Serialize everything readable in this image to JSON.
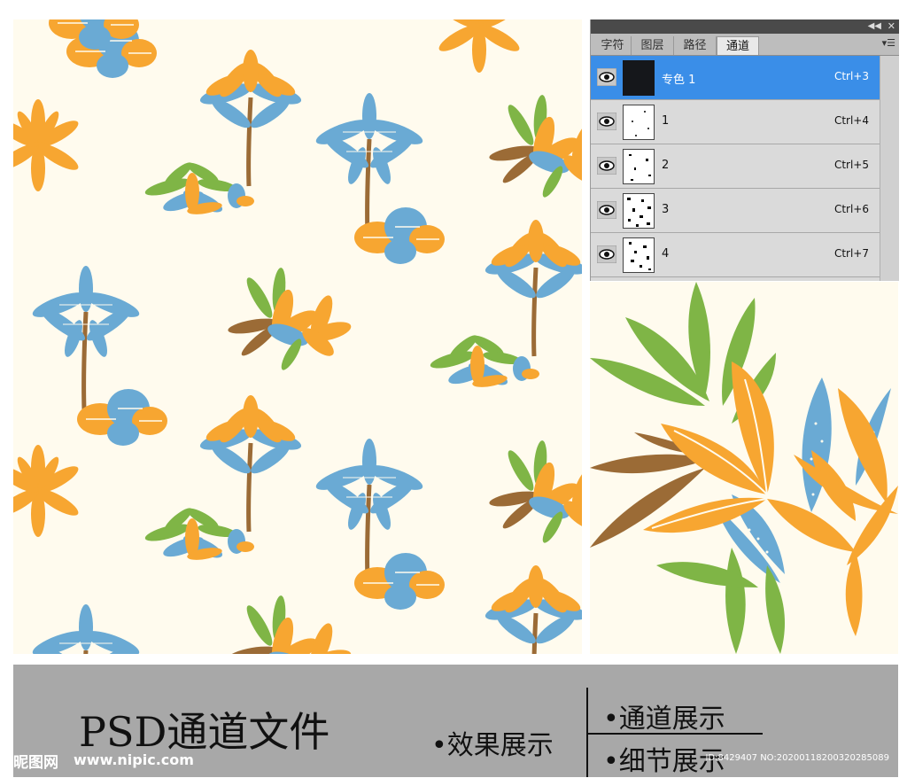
{
  "channels_panel": {
    "collapse_icon": "double-chevron-icon",
    "close_icon": "close-icon",
    "tabs": [
      {
        "label": "字符",
        "active": false
      },
      {
        "label": "图层",
        "active": false
      },
      {
        "label": "路径",
        "active": false
      },
      {
        "label": "通道",
        "active": true
      }
    ],
    "menu_icon": "panel-menu-icon",
    "channels": [
      {
        "name": "专色 1",
        "shortcut": "Ctrl+3",
        "selected": true
      },
      {
        "name": "1",
        "shortcut": "Ctrl+4",
        "selected": false
      },
      {
        "name": "2",
        "shortcut": "Ctrl+5",
        "selected": false
      },
      {
        "name": "3",
        "shortcut": "Ctrl+6",
        "selected": false
      },
      {
        "name": "4",
        "shortcut": "Ctrl+7",
        "selected": false
      }
    ]
  },
  "banner": {
    "title": "PSD通道文件",
    "bullet_effect": "•效果展示",
    "bullet_channel": "•通道展示",
    "bullet_detail": "•细节展示"
  },
  "watermark": {
    "logo": "昵图网",
    "site": "www.nipic.com",
    "id_text": "ID:8429407 NO:20200118200320285089"
  },
  "colors": {
    "background": "#fffbee",
    "orange": "#f7a631",
    "blue": "#6aaad4",
    "green": "#7fb546",
    "brown": "#9b6b36",
    "panel": "#d8d8d8",
    "selected": "#3a8ee8",
    "banner": "#a8a8a8"
  }
}
